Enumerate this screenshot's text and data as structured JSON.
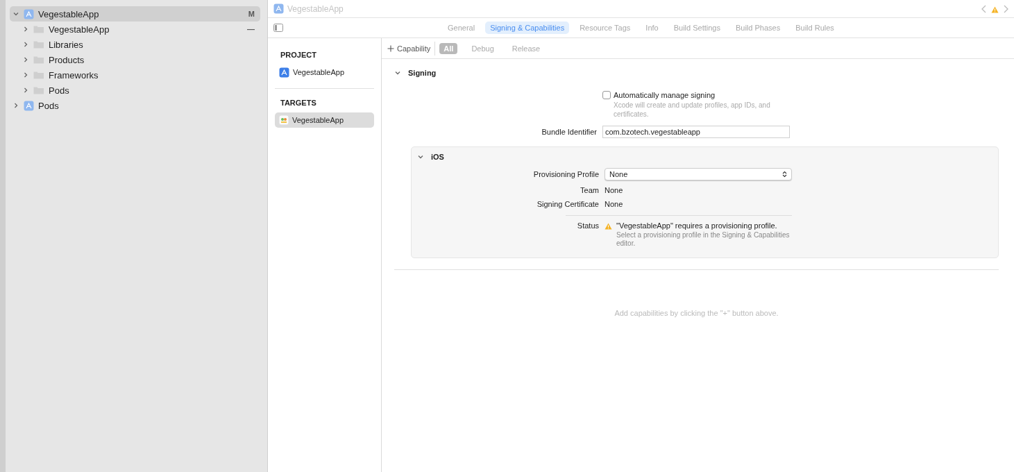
{
  "navigator": {
    "items": [
      {
        "label": "VegestableApp",
        "kind": "project",
        "expanded": true,
        "selected": true,
        "badge": "M",
        "children": [
          {
            "label": "VegestableApp",
            "kind": "folder",
            "expanded": false,
            "selected": false,
            "badge": "—"
          },
          {
            "label": "Libraries",
            "kind": "folder",
            "expanded": false,
            "selected": false
          },
          {
            "label": "Products",
            "kind": "folder",
            "expanded": false,
            "selected": false
          },
          {
            "label": "Frameworks",
            "kind": "folder",
            "expanded": false,
            "selected": false
          },
          {
            "label": "Pods",
            "kind": "folder",
            "expanded": false,
            "selected": false
          }
        ]
      },
      {
        "label": "Pods",
        "kind": "project",
        "expanded": false,
        "selected": false
      }
    ]
  },
  "jump_bar": {
    "title": "VegestableApp"
  },
  "tabs": [
    {
      "label": "General",
      "selected": false
    },
    {
      "label": "Signing & Capabilities",
      "selected": true
    },
    {
      "label": "Resource Tags",
      "selected": false
    },
    {
      "label": "Info",
      "selected": false
    },
    {
      "label": "Build Settings",
      "selected": false
    },
    {
      "label": "Build Phases",
      "selected": false
    },
    {
      "label": "Build Rules",
      "selected": false
    }
  ],
  "targets_panel": {
    "sections": [
      {
        "heading": "PROJECT",
        "items": [
          {
            "label": "VegestableApp",
            "kind": "project",
            "selected": false
          }
        ]
      },
      {
        "heading": "TARGETS",
        "items": [
          {
            "label": "VegestableApp",
            "kind": "app",
            "selected": true
          }
        ]
      }
    ]
  },
  "toolbar": {
    "add_button": "Capability",
    "filters": [
      {
        "label": "All",
        "selected": true
      },
      {
        "label": "Debug",
        "selected": false
      },
      {
        "label": "Release",
        "selected": false
      }
    ]
  },
  "signing": {
    "title": "Signing",
    "expanded": true,
    "auto_manage": {
      "label": "Automatically manage signing",
      "checked": false,
      "hint": "Xcode will create and update profiles, app IDs, and certificates."
    },
    "bundle_identifier": {
      "label": "Bundle Identifier",
      "value": "com.bzotech.vegestableapp"
    },
    "platform": {
      "title": "iOS",
      "expanded": true,
      "provisioning_profile": {
        "label": "Provisioning Profile",
        "value": "None"
      },
      "team": {
        "label": "Team",
        "value": "None"
      },
      "signing_certificate": {
        "label": "Signing Certificate",
        "value": "None"
      },
      "status": {
        "label": "Status",
        "message": "\"VegestableApp\" requires a provisioning profile.",
        "detail": "Select a provisioning profile in the Signing & Capabilities editor."
      }
    }
  },
  "empty_hint": "Add capabilities by clicking the \"+\" button above."
}
